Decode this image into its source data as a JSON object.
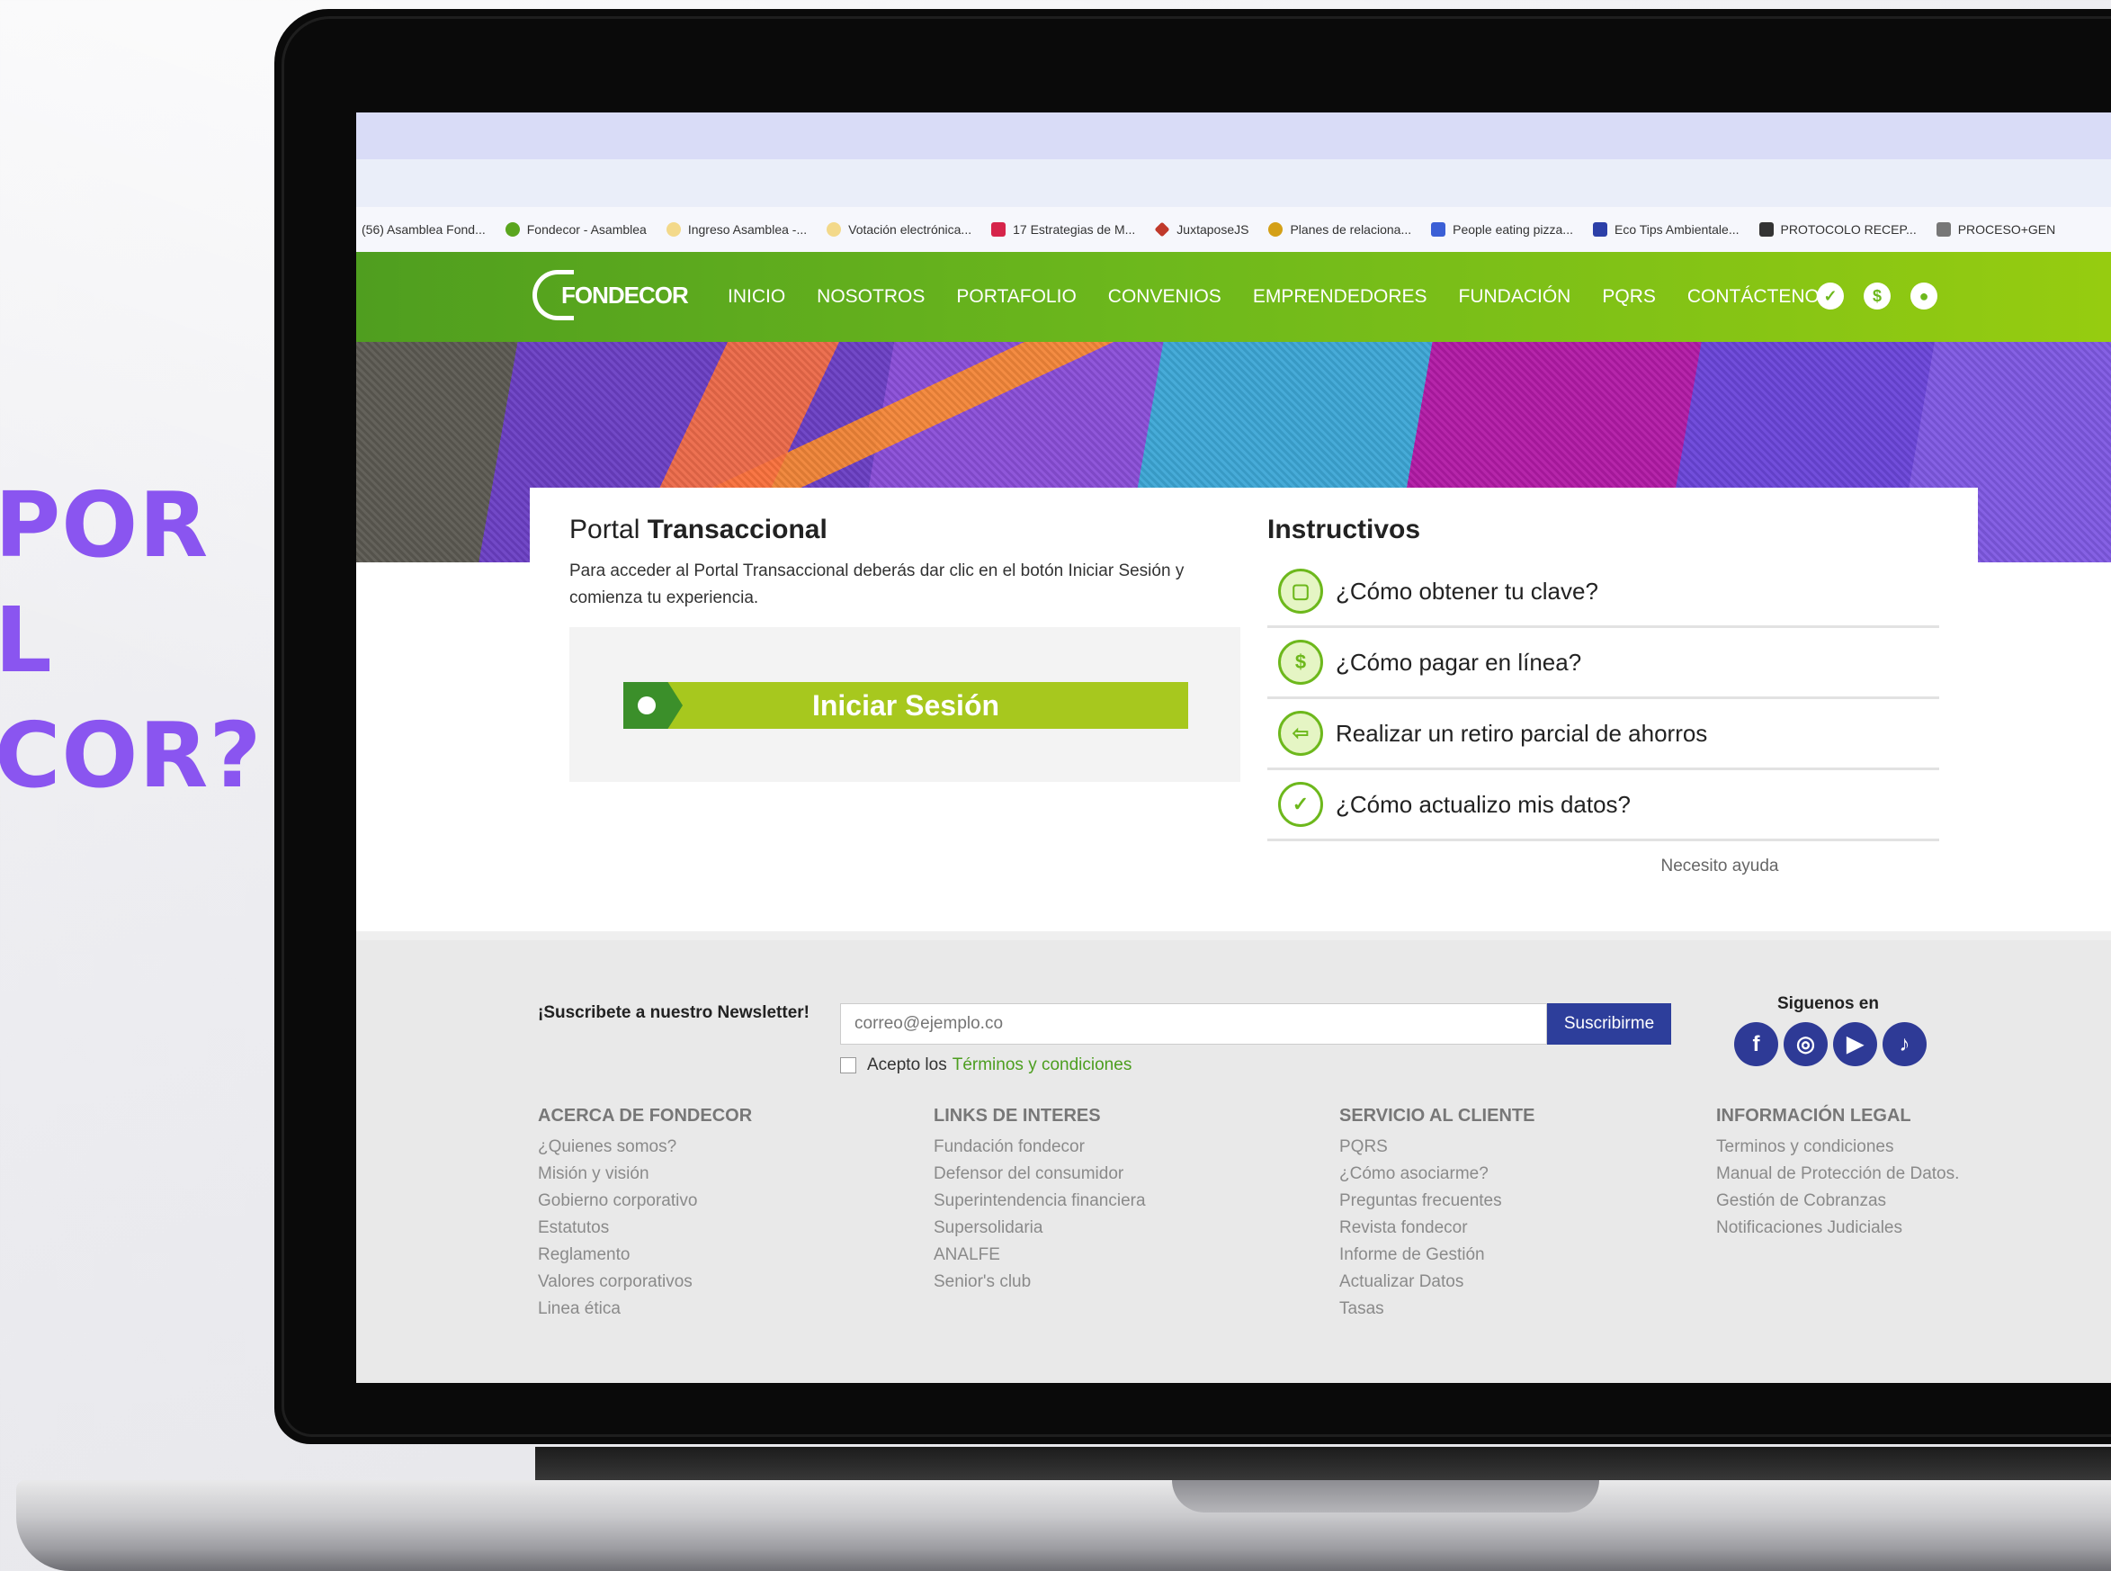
{
  "promo": {
    "line1": "POR",
    "line2": "L",
    "line3": "COR?"
  },
  "bookmarks": [
    {
      "label": "(56) Asamblea Fond...",
      "color": ""
    },
    {
      "label": "Fondecor - Asamblea",
      "color": "#5aa51e"
    },
    {
      "label": "Ingreso Asamblea -...",
      "color": "#e6c04a"
    },
    {
      "label": "Votación electrónica...",
      "color": "#e6c04a"
    },
    {
      "label": "17 Estrategias de M...",
      "color": "#d6244a"
    },
    {
      "label": "JuxtaposeJS",
      "color": "#c0392b"
    },
    {
      "label": "Planes de relaciona...",
      "color": "#d4a017"
    },
    {
      "label": "People eating pizza...",
      "color": "#3b5fd6"
    },
    {
      "label": "Eco Tips Ambientale...",
      "color": "#2c3fa8"
    },
    {
      "label": "PROTOCOLO RECEP...",
      "color": "#333333"
    },
    {
      "label": "PROCESO+GEN",
      "color": "#777777"
    }
  ],
  "nav": {
    "logo": "FONDECOR",
    "items": [
      "INICIO",
      "NOSOTROS",
      "PORTAFOLIO",
      "CONVENIOS",
      "EMPRENDEDORES",
      "FUNDACIÓN",
      "PQRS",
      "CONTÁCTENOS"
    ],
    "icons": [
      "check-icon",
      "dollar-icon",
      "user-icon"
    ]
  },
  "portal": {
    "title_light": "Portal ",
    "title_bold": "Transaccional",
    "description": "Para acceder al Portal Transaccional deberás dar clic en el botón Iniciar Sesión y comienza tu experiencia.",
    "login_label": "Iniciar Sesión"
  },
  "instructivos": {
    "title": "Instructivos",
    "items": [
      {
        "label": "¿Cómo obtener tu clave?",
        "icon": "lock-icon"
      },
      {
        "label": "¿Cómo pagar en línea?",
        "icon": "dollar-icon"
      },
      {
        "label": "Realizar un retiro parcial de ahorros",
        "icon": "arrow-left-icon"
      },
      {
        "label": "¿Cómo actualizo mis datos?",
        "icon": "check-icon"
      }
    ],
    "help": "Necesito ayuda"
  },
  "footer": {
    "newsletter_label": "¡Suscribete a nuestro Newsletter!",
    "email_placeholder": "correo@ejemplo.co",
    "subscribe": "Suscribirme",
    "terms_prefix": "Acepto los",
    "terms_link": "Términos y condiciones",
    "follow": "Siguenos en",
    "columns": [
      {
        "title": "ACERCA DE FONDECOR",
        "links": [
          "¿Quienes somos?",
          "Misión y visión",
          "Gobierno corporativo",
          "Estatutos",
          "Reglamento",
          "Valores corporativos",
          "Linea ética"
        ]
      },
      {
        "title": "LINKS DE INTERES",
        "links": [
          "Fundación fondecor",
          "Defensor del consumidor",
          "Superintendencia financiera",
          "Supersolidaria",
          "ANALFE",
          "Senior's club"
        ]
      },
      {
        "title": "SERVICIO AL CLIENTE",
        "links": [
          "PQRS",
          "¿Cómo asociarme?",
          "Preguntas frecuentes",
          "Revista fondecor",
          "Informe de Gestión",
          "Actualizar Datos",
          "Tasas"
        ]
      },
      {
        "title": "INFORMACIÓN LEGAL",
        "links": [
          "Terminos y condiciones",
          "Manual de Protección de Datos.",
          "Gestión de Cobranzas",
          "Notificaciones Judiciales"
        ]
      }
    ]
  },
  "colors": {
    "accent_green": "#6db81c",
    "button_green": "#a7c81e",
    "social_blue": "#2e3a96",
    "promo_purple": "#8a55f0"
  }
}
